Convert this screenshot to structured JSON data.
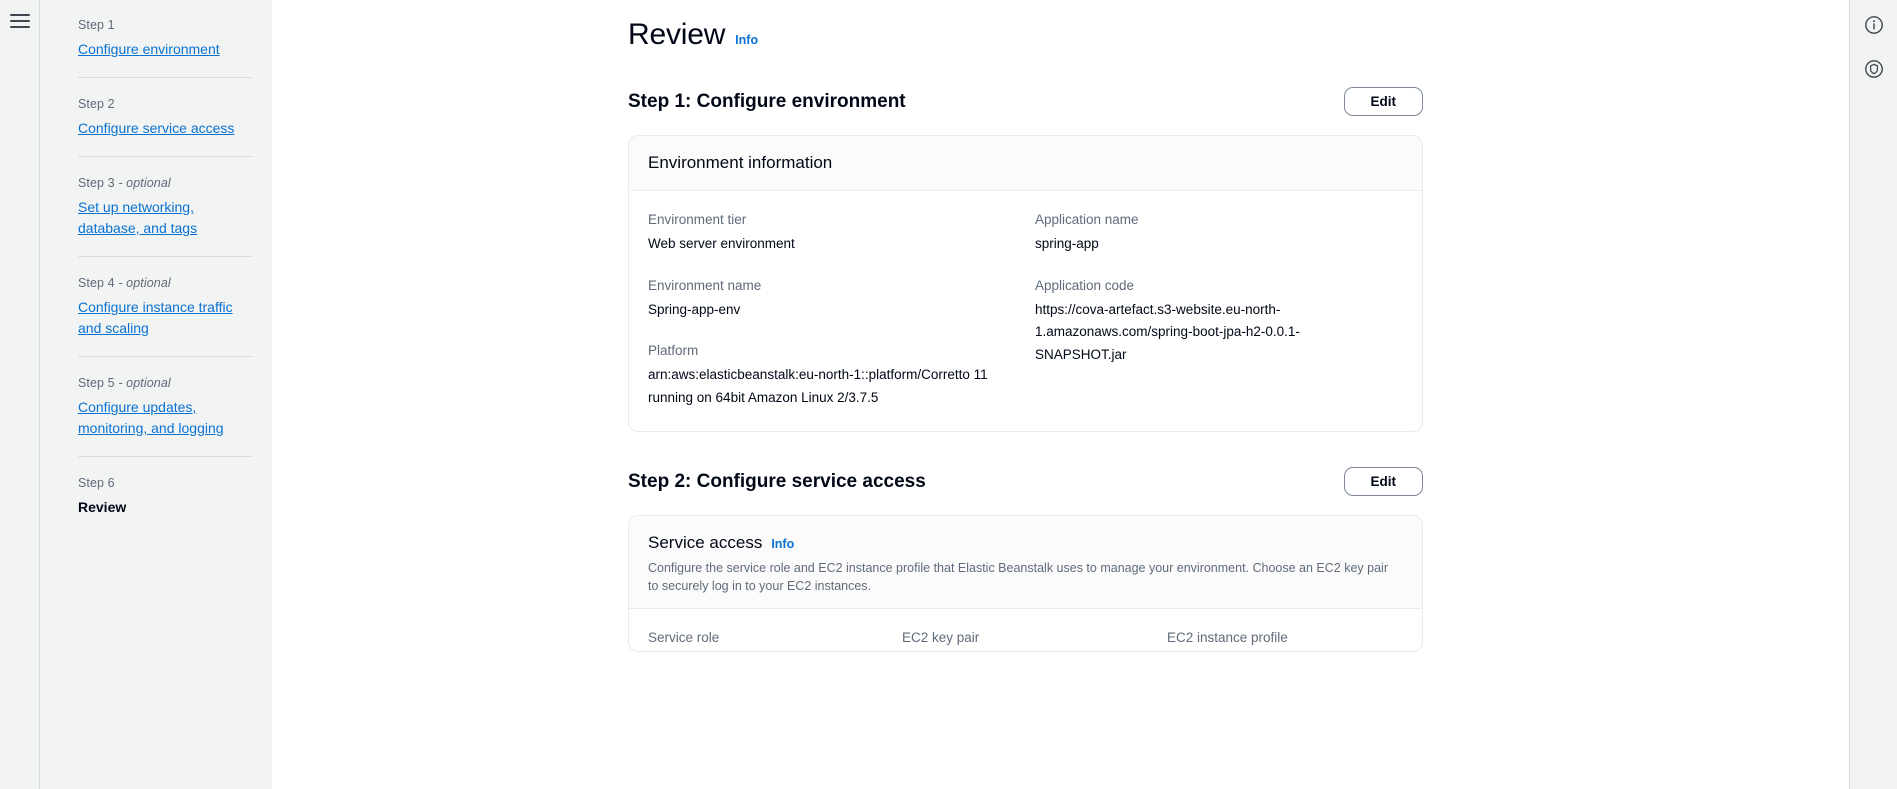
{
  "window": {
    "menu_icon": "hamburger-menu-icon"
  },
  "sidebar": {
    "steps": [
      {
        "label": "Step 1",
        "optional": "",
        "title": "Configure environment",
        "current": false
      },
      {
        "label": "Step 2",
        "optional": "",
        "title": "Configure service access",
        "current": false
      },
      {
        "label": "Step 3",
        "optional": " - optional",
        "title": "Set up networking, database, and tags",
        "current": false
      },
      {
        "label": "Step 4",
        "optional": " - optional",
        "title": "Configure instance traffic and scaling",
        "current": false
      },
      {
        "label": "Step 5",
        "optional": " - optional",
        "title": "Configure updates, monitoring, and logging",
        "current": false
      },
      {
        "label": "Step 6",
        "optional": "",
        "title": "Review",
        "current": true
      }
    ]
  },
  "page": {
    "title": "Review",
    "info_label": "Info"
  },
  "sections": [
    {
      "heading": "Step 1: Configure environment",
      "edit_label": "Edit",
      "card": {
        "title": "Environment information",
        "info_label": "",
        "description": "",
        "fields_left": [
          {
            "label": "Environment tier",
            "value": "Web server environment"
          },
          {
            "label": "Environment name",
            "value": "Spring-app-env"
          },
          {
            "label": "Platform",
            "value": "arn:aws:elasticbeanstalk:eu-north-1::platform/Corretto 11 running on 64bit Amazon Linux 2/3.7.5"
          }
        ],
        "fields_right": [
          {
            "label": "Application name",
            "value": "spring-app"
          },
          {
            "label": "Application code",
            "value": "https://cova-artefact.s3-website.eu-north-1.amazonaws.com/spring-boot-jpa-h2-0.0.1-SNAPSHOT.jar"
          }
        ]
      }
    },
    {
      "heading": "Step 2: Configure service access",
      "edit_label": "Edit",
      "card": {
        "title": "Service access",
        "info_label": "Info",
        "description": "Configure the service role and EC2 instance profile that Elastic Beanstalk uses to manage your environment. Choose an EC2 key pair to securely log in to your EC2 instances.",
        "columns": [
          {
            "label": "Service role"
          },
          {
            "label": "EC2 key pair"
          },
          {
            "label": "EC2 instance profile"
          }
        ]
      }
    }
  ],
  "rail_right": {
    "buttons": [
      {
        "icon": "info-circle-icon"
      },
      {
        "icon": "shield-circle-icon"
      }
    ]
  },
  "colors": {
    "link": "#0972d3",
    "text": "#000716",
    "muted": "#5f6b7a",
    "sidebar_bg": "#f2f3f3",
    "card_border": "#e9ebed"
  }
}
